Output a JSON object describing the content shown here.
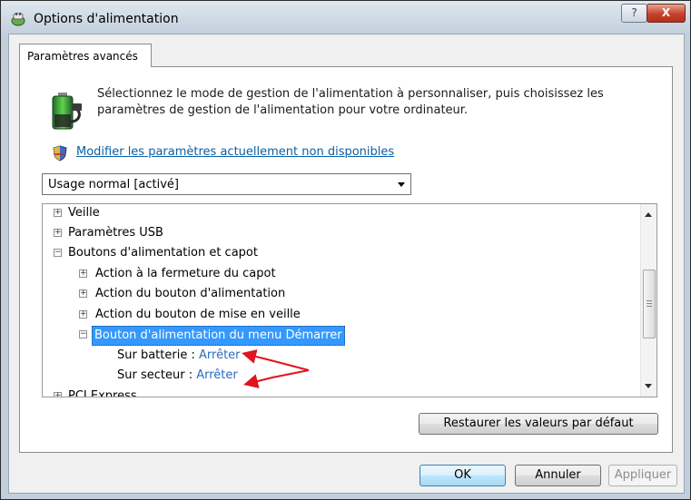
{
  "window": {
    "title": "Options d'alimentation",
    "help_label": "?",
    "close_label": "X"
  },
  "tab": {
    "label": "Paramètres avancés"
  },
  "description": "Sélectionnez le mode de gestion de l'alimentation à personnaliser, puis choisissez les paramètres de gestion de l'alimentation pour votre ordinateur.",
  "link": {
    "label": "Modifier les paramètres actuellement non disponibles"
  },
  "plan_select": {
    "value": "Usage normal [activé]"
  },
  "tree": {
    "items": [
      {
        "label": "Veille",
        "expander": "+"
      },
      {
        "label": "Paramètres USB",
        "expander": "+"
      },
      {
        "label": "Boutons d'alimentation et capot",
        "expander": "−"
      },
      {
        "label": "Action à la fermeture du capot",
        "expander": "+"
      },
      {
        "label": "Action du bouton d'alimentation",
        "expander": "+"
      },
      {
        "label": "Action du bouton de mise en veille",
        "expander": "+"
      },
      {
        "label": "Bouton d'alimentation du menu Démarrer",
        "expander": "−",
        "selected": true
      },
      {
        "label": "PCI Express",
        "expander": "+"
      }
    ],
    "values": [
      {
        "label": "Sur batterie :",
        "value": "Arrêter"
      },
      {
        "label": "Sur secteur :",
        "value": "Arrêter"
      }
    ]
  },
  "buttons": {
    "restore_label": "Restaurer les valeurs par défaut",
    "ok_label": "OK",
    "cancel_label": "Annuler",
    "apply_label": "Appliquer"
  },
  "colors": {
    "link": "#0b5fa5",
    "selection": "#3399ff",
    "annotation_arrow": "#e0141e"
  }
}
